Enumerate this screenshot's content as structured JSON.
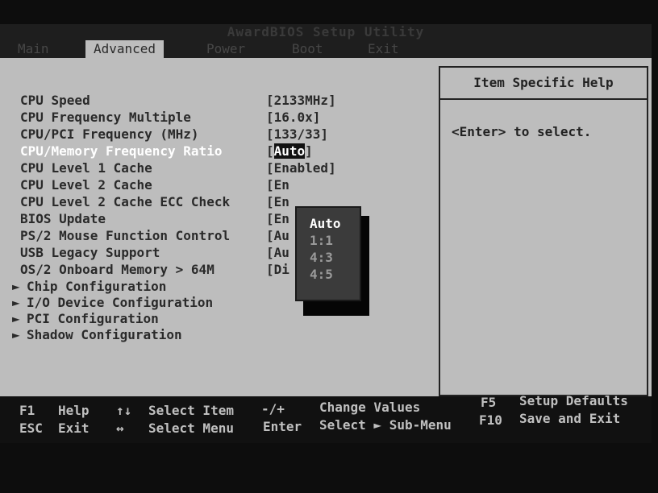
{
  "title": "AwardBIOS Setup Utility",
  "tabs": [
    {
      "label": "Main"
    },
    {
      "label": "Advanced"
    },
    {
      "label": "Power"
    },
    {
      "label": "Boot"
    },
    {
      "label": "Exit"
    }
  ],
  "settings": [
    {
      "label": "CPU Speed",
      "value": "[2133MHz]"
    },
    {
      "label": "CPU Frequency Multiple",
      "value": "[16.0x]"
    },
    {
      "label": "CPU/PCI Frequency (MHz)",
      "value": "[133/33]"
    },
    {
      "label": "CPU/Memory Frequency Ratio",
      "value_open": "[",
      "value_hl": "Auto",
      "value_close": "]"
    },
    {
      "label": "CPU Level 1 Cache",
      "value": "[Enabled]"
    },
    {
      "label": "CPU Level 2 Cache",
      "value": "[En"
    },
    {
      "label": "CPU Level 2 Cache ECC Check",
      "value": "[En"
    },
    {
      "label": "BIOS Update",
      "value": "[En"
    },
    {
      "label": "PS/2 Mouse Function Control",
      "value": "[Au"
    },
    {
      "label": "USB Legacy Support",
      "value": "[Au"
    },
    {
      "label": "OS/2 Onboard Memory > 64M",
      "value": "[Di"
    }
  ],
  "submenus": [
    {
      "label": "Chip Configuration"
    },
    {
      "label": "I/O Device Configuration"
    },
    {
      "label": "PCI Configuration"
    },
    {
      "label": "Shadow Configuration"
    }
  ],
  "popup_options": [
    "Auto",
    "1:1",
    "4:3",
    "4:5"
  ],
  "help": {
    "title": "Item Specific Help",
    "text": "<Enter> to select."
  },
  "footer": {
    "f1_key": "F1",
    "f1_label": "Help",
    "esc_key": "ESC",
    "esc_label": "Exit",
    "updown_key": "↑↓",
    "updown_label": "Select Item",
    "leftright_key": "↔",
    "leftright_label": "Select Menu",
    "minusplus_key": "-/+",
    "minusplus_label": "Change Values",
    "enter_key": "Enter",
    "enter_label": "Select ► Sub-Menu",
    "f5_key": "F5",
    "f5_label": "Setup Defaults",
    "f10_key": "F10",
    "f10_label": "Save and Exit"
  }
}
